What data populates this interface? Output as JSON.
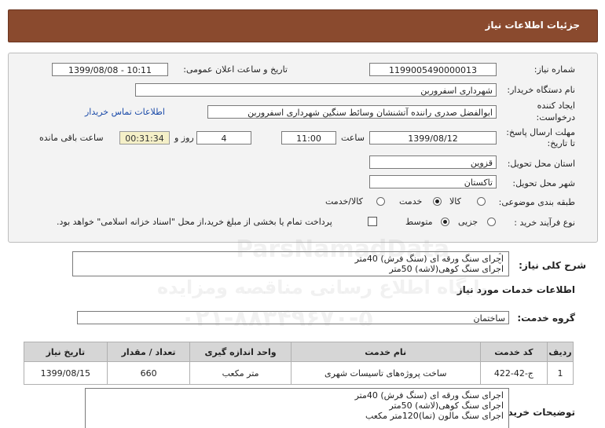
{
  "header": {
    "title": "جزئیات اطلاعات نیاز"
  },
  "form": {
    "need_number_label": "شماره نیاز:",
    "need_number": "1199005490000013",
    "announce_label": "تاریخ و ساعت اعلان عمومی:",
    "announce_value": "1399/08/08 - 10:11",
    "buyer_org_label": "نام دستگاه خریدار:",
    "buyer_org": "شهرداری اسفروربن",
    "creator_label_line1": "ایجاد کننده",
    "creator_label_line2": "درخواست:",
    "creator": "ابوالفضل صدری راننده آتشنشان وسائط سنگین شهرداری اسفروربن",
    "contact_link": "اطلاعات تماس خریدار",
    "deadline_label_line1": "مهلت ارسال پاسخ:",
    "deadline_label_line2": "تا تاریخ:",
    "deadline_date": "1399/08/12",
    "time_label": "ساعت",
    "deadline_time": "11:00",
    "days_value": "4",
    "days_label": "روز و",
    "remaining_time": "00:31:34",
    "remaining_label": "ساعت باقی مانده",
    "province_label": "استان محل تحویل:",
    "province": "قزوین",
    "city_label": "شهر محل تحویل:",
    "city": "تاکستان",
    "category_label": "طبقه بندی موضوعی:",
    "category_options": [
      "کالا",
      "خدمت",
      "کالا/خدمت"
    ],
    "category_selected": "خدمت",
    "process_label": "نوع فرآیند خرید :",
    "process_options": [
      "جزیی",
      "متوسط"
    ],
    "process_selected": "متوسط",
    "payment_note": "پرداخت تمام یا بخشی از مبلغ خرید،از محل \"اسناد خزانه اسلامی\" خواهد بود."
  },
  "description": {
    "label": "شرح کلی نیاز:",
    "lines": [
      "اجرای سنگ ورقه ای (سنگ فرش) 40متر",
      "اجرای سنگ کوهی(لاشه) 50متر"
    ]
  },
  "services": {
    "section_title": "اطلاعات خدمات مورد نیاز",
    "group_label": "گروه خدمت:",
    "group_value": "ساختمان",
    "columns": [
      "ردیف",
      "کد خدمت",
      "نام خدمت",
      "واحد اندازه گیری",
      "تعداد / مقدار",
      "تاریخ نیاز"
    ],
    "rows": [
      {
        "row": "1",
        "code": "ج-42-422",
        "name": "ساخت پروژه‌های تاسیسات شهری",
        "unit": "متر مکعب",
        "qty": "660",
        "date": "1399/08/15"
      }
    ]
  },
  "buyer_notes": {
    "label": "توضیحات خریدار:",
    "lines": [
      "اجرای سنگ ورقه ای (سنگ فرش) 40متر",
      "اجرای سنگ کوهی(لاشه) 50متر",
      "اجرای سنگ مالون (تما)120متر مکعب"
    ]
  },
  "watermark": {
    "line1": "ParsNamadData",
    "line2": "پایگاه اطلاع رسانی مناقصه ومزایده",
    "line3": "۰۲۱-۸۸۳۴۹۶۷۰-۵"
  }
}
